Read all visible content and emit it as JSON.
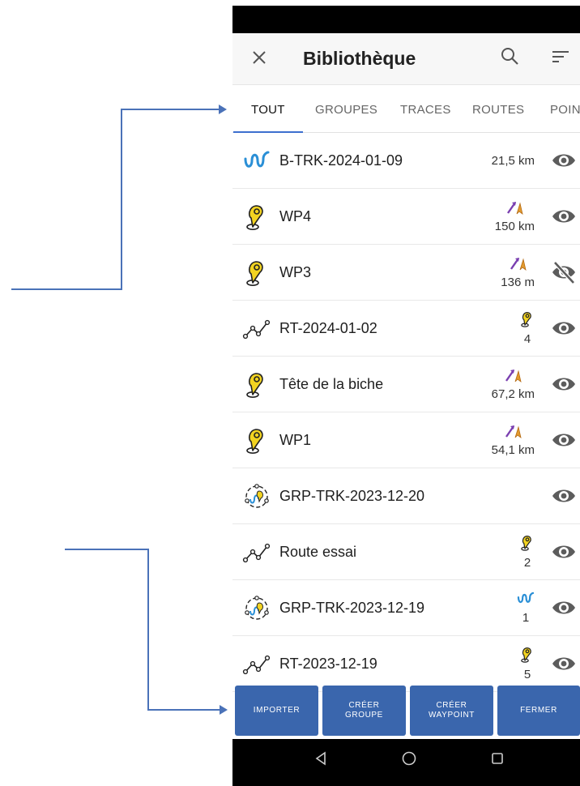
{
  "app": {
    "title": "Bibliothèque"
  },
  "tabs": [
    {
      "label": "TOUT"
    },
    {
      "label": "GROUPES"
    },
    {
      "label": "TRACES"
    },
    {
      "label": "ROUTES"
    },
    {
      "label": "POIN"
    }
  ],
  "items": [
    {
      "name": "B-TRK-2024-01-09",
      "type": "track",
      "info": "21,5 km",
      "visible": true
    },
    {
      "name": "WP4",
      "type": "waypoint",
      "info_icon": "direction-icon",
      "info": "150 km",
      "visible": true
    },
    {
      "name": "WP3",
      "type": "waypoint",
      "info_icon": "direction-icon",
      "info": "136 m",
      "visible": false
    },
    {
      "name": "RT-2024-01-02",
      "type": "route",
      "info_icon": "waypoint-icon",
      "info": "4",
      "visible": true
    },
    {
      "name": "Tête de la biche",
      "type": "waypoint",
      "info_icon": "direction-icon",
      "info": "67,2 km",
      "visible": true
    },
    {
      "name": "WP1",
      "type": "waypoint",
      "info_icon": "direction-icon",
      "info": "54,1 km",
      "visible": true
    },
    {
      "name": "GRP-TRK-2023-12-20",
      "type": "group",
      "info": "",
      "visible": true
    },
    {
      "name": "Route essai",
      "type": "route",
      "info_icon": "waypoint-icon",
      "info": "2",
      "visible": true
    },
    {
      "name": "GRP-TRK-2023-12-19",
      "type": "group",
      "info_icon": "track-icon",
      "info": "1",
      "visible": true
    },
    {
      "name": "RT-2023-12-19",
      "type": "route",
      "info_icon": "waypoint-icon",
      "info": "5",
      "visible": true
    }
  ],
  "buttons": {
    "import": "IMPORTER",
    "create_group_1": "CRÉER",
    "create_group_2": "GROUPE",
    "create_waypoint_1": "CRÉER",
    "create_waypoint_2": "WAYPOINT",
    "close": "FERMER"
  },
  "colors": {
    "accent": "#3a66ad",
    "annotation": "#4a72b8",
    "track": "#2a8fd6",
    "waypoint": "#f2d321",
    "direction_arrow": "#7a3fb0",
    "direction_target": "#e39b2e"
  }
}
